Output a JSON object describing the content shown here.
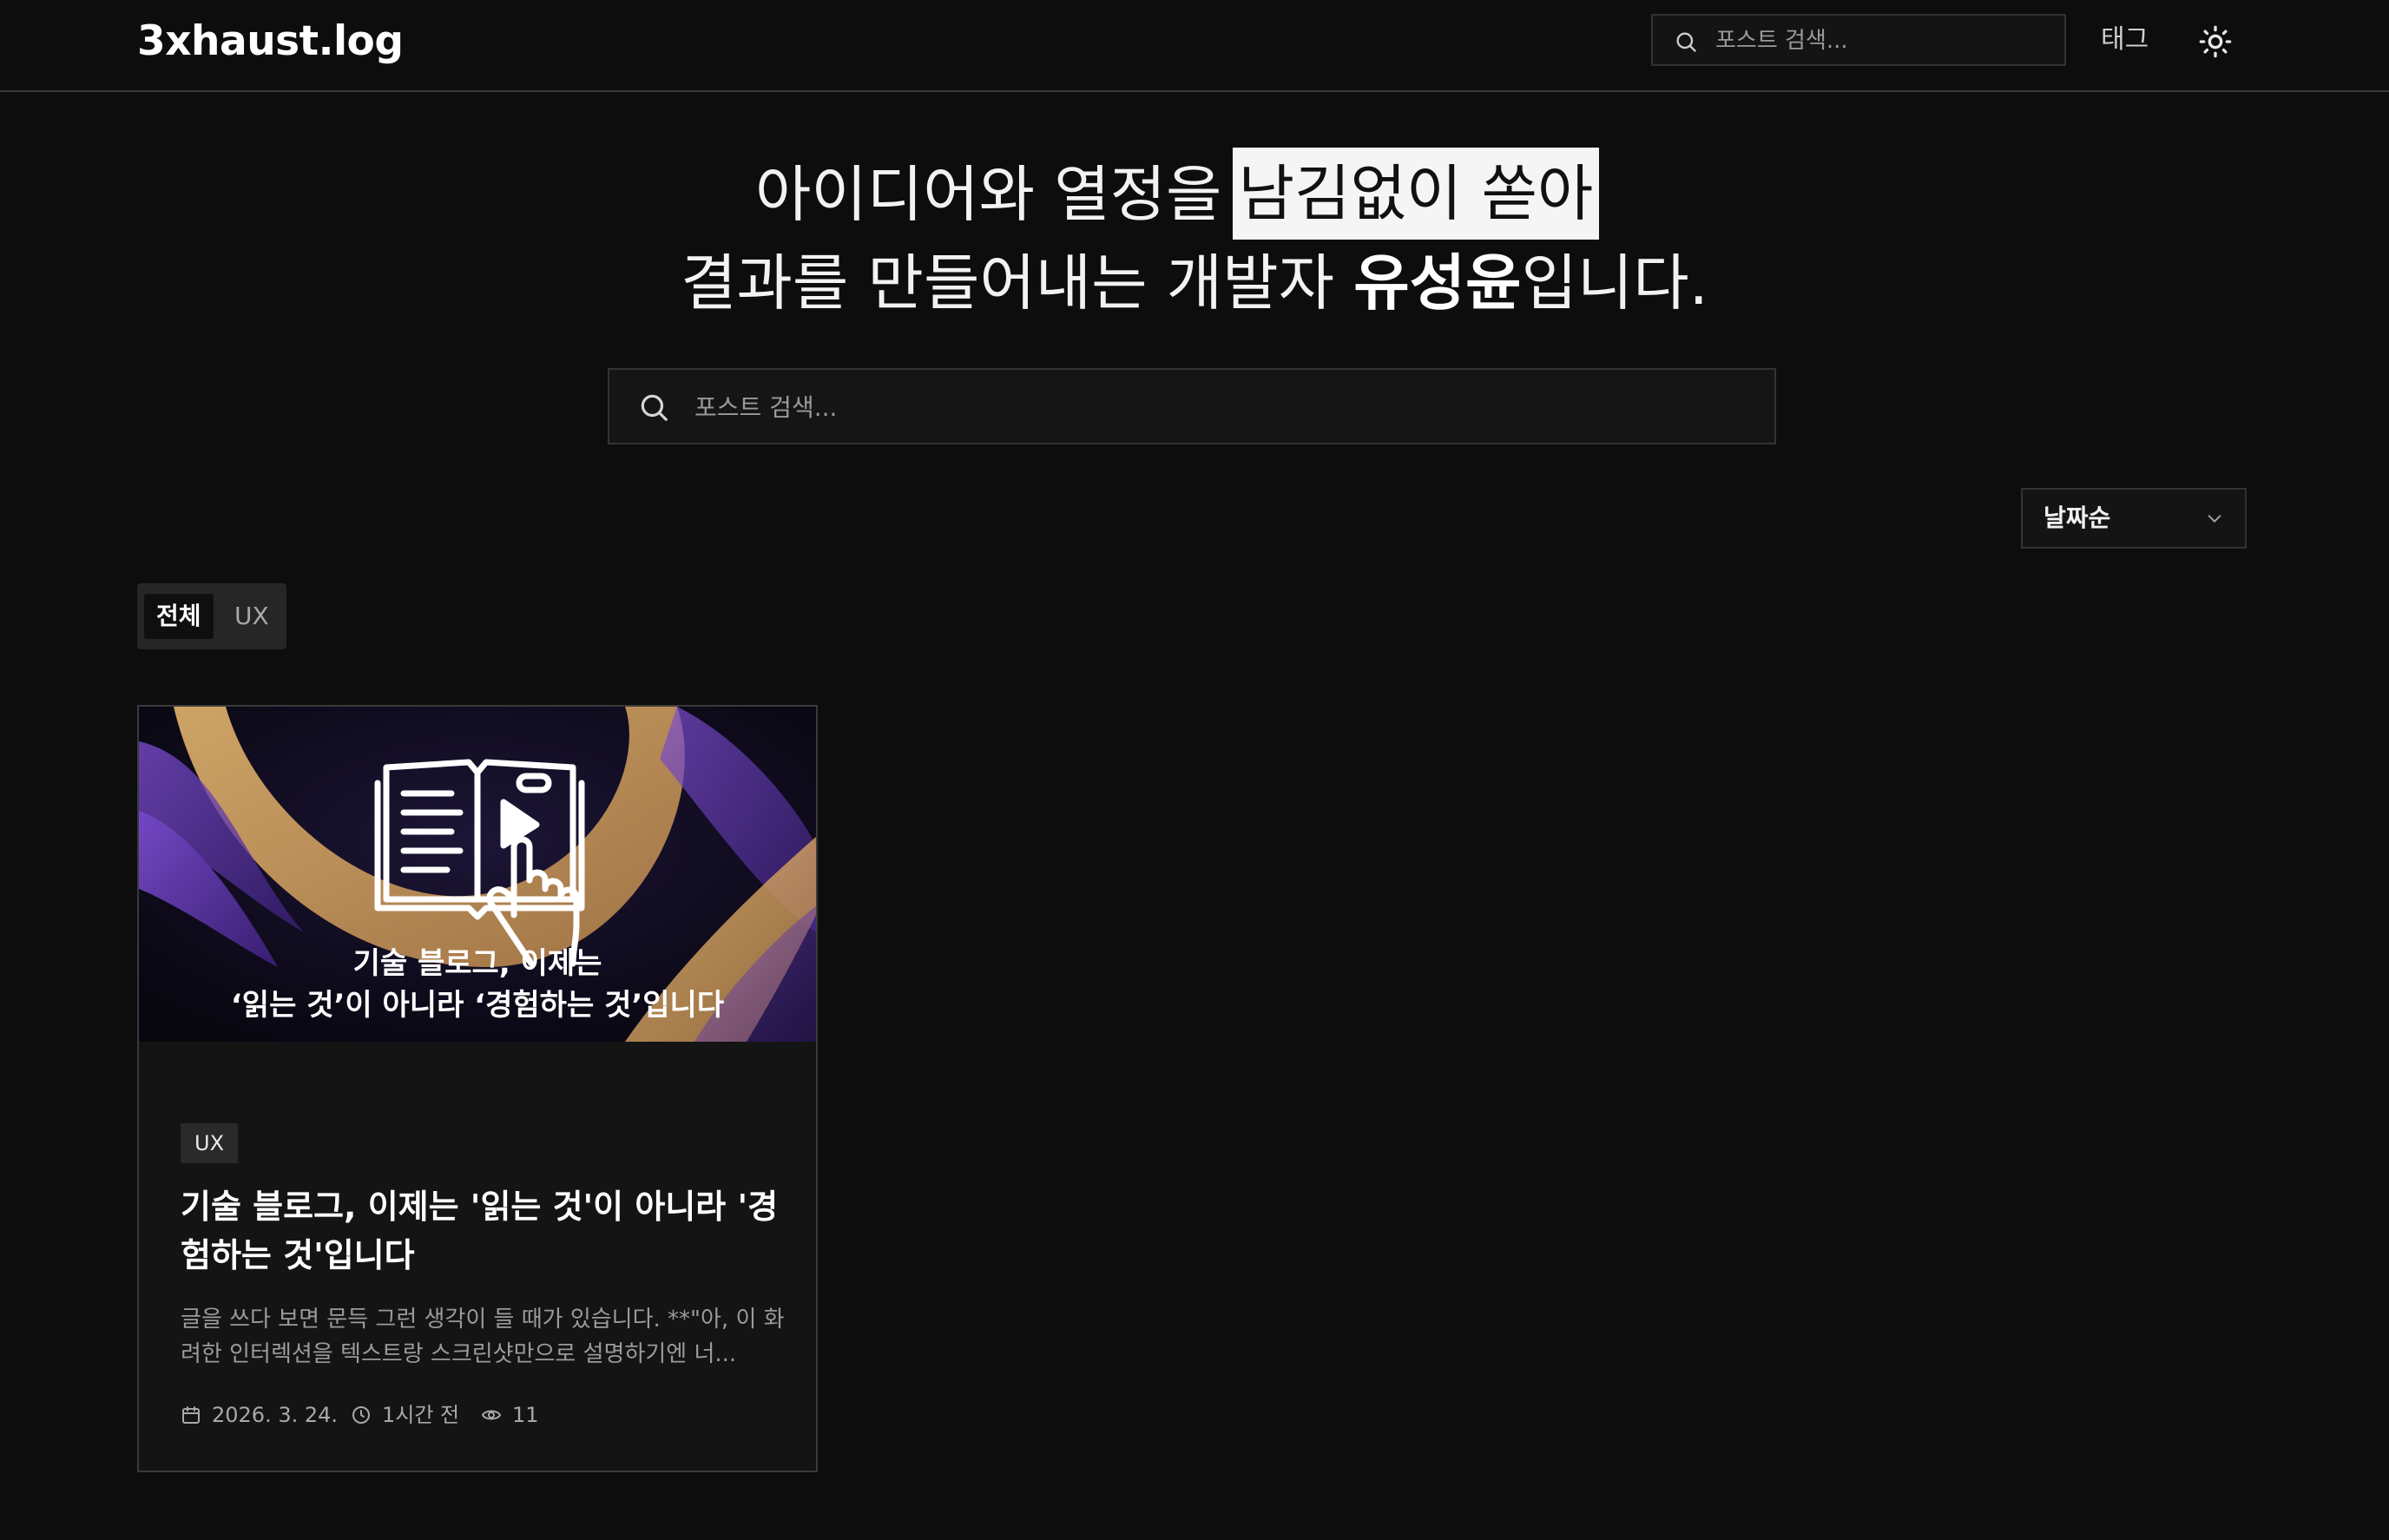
{
  "site": {
    "logo": "3xhaust.log"
  },
  "header": {
    "search_placeholder": "포스트 검색...",
    "tags_label": "태그",
    "theme_icon": "sun-icon"
  },
  "hero": {
    "line1_plain": "아이디어와 열정을",
    "line1_highlight": "남김없이 쏟아",
    "line2_pre": "결과를 만들어내는 개발자 ",
    "line2_name": "유성윤",
    "line2_post": "입니다."
  },
  "main_search": {
    "placeholder": "포스트 검색..."
  },
  "sort": {
    "selected": "날짜순",
    "icon": "chevron-down-icon"
  },
  "categories": [
    {
      "label": "전체",
      "active": true
    },
    {
      "label": "UX",
      "active": false
    }
  ],
  "posts": [
    {
      "thumbnail": {
        "caption_line1": "기술 블로그, 이제는",
        "caption_line2": "‘읽는 것’이 아니라 ‘경험하는 것’입니다",
        "icon": "book-touch-icon",
        "colors": {
          "background": "#120e2a",
          "gold": "#e9b46a",
          "purple": "#6a3fc2"
        }
      },
      "category": "UX",
      "title": "기술 블로그, 이제는 '읽는 것'이 아니라 '경험하는 것'입니다",
      "excerpt": "글을 쓰다 보면 문득 그런 생각이 들 때가 있습니다. **\"아, 이 화려한 인터렉션을 텍스트랑 스크린샷만으로 설명하기엔 너...",
      "date": "2026. 3. 24.",
      "read_time": "1시간 전",
      "views": "11"
    }
  ],
  "colors": {
    "background": "#0d0d0d",
    "text": "#f2f2f2",
    "highlight_bg": "#f5f5f5",
    "border": "#333333"
  }
}
